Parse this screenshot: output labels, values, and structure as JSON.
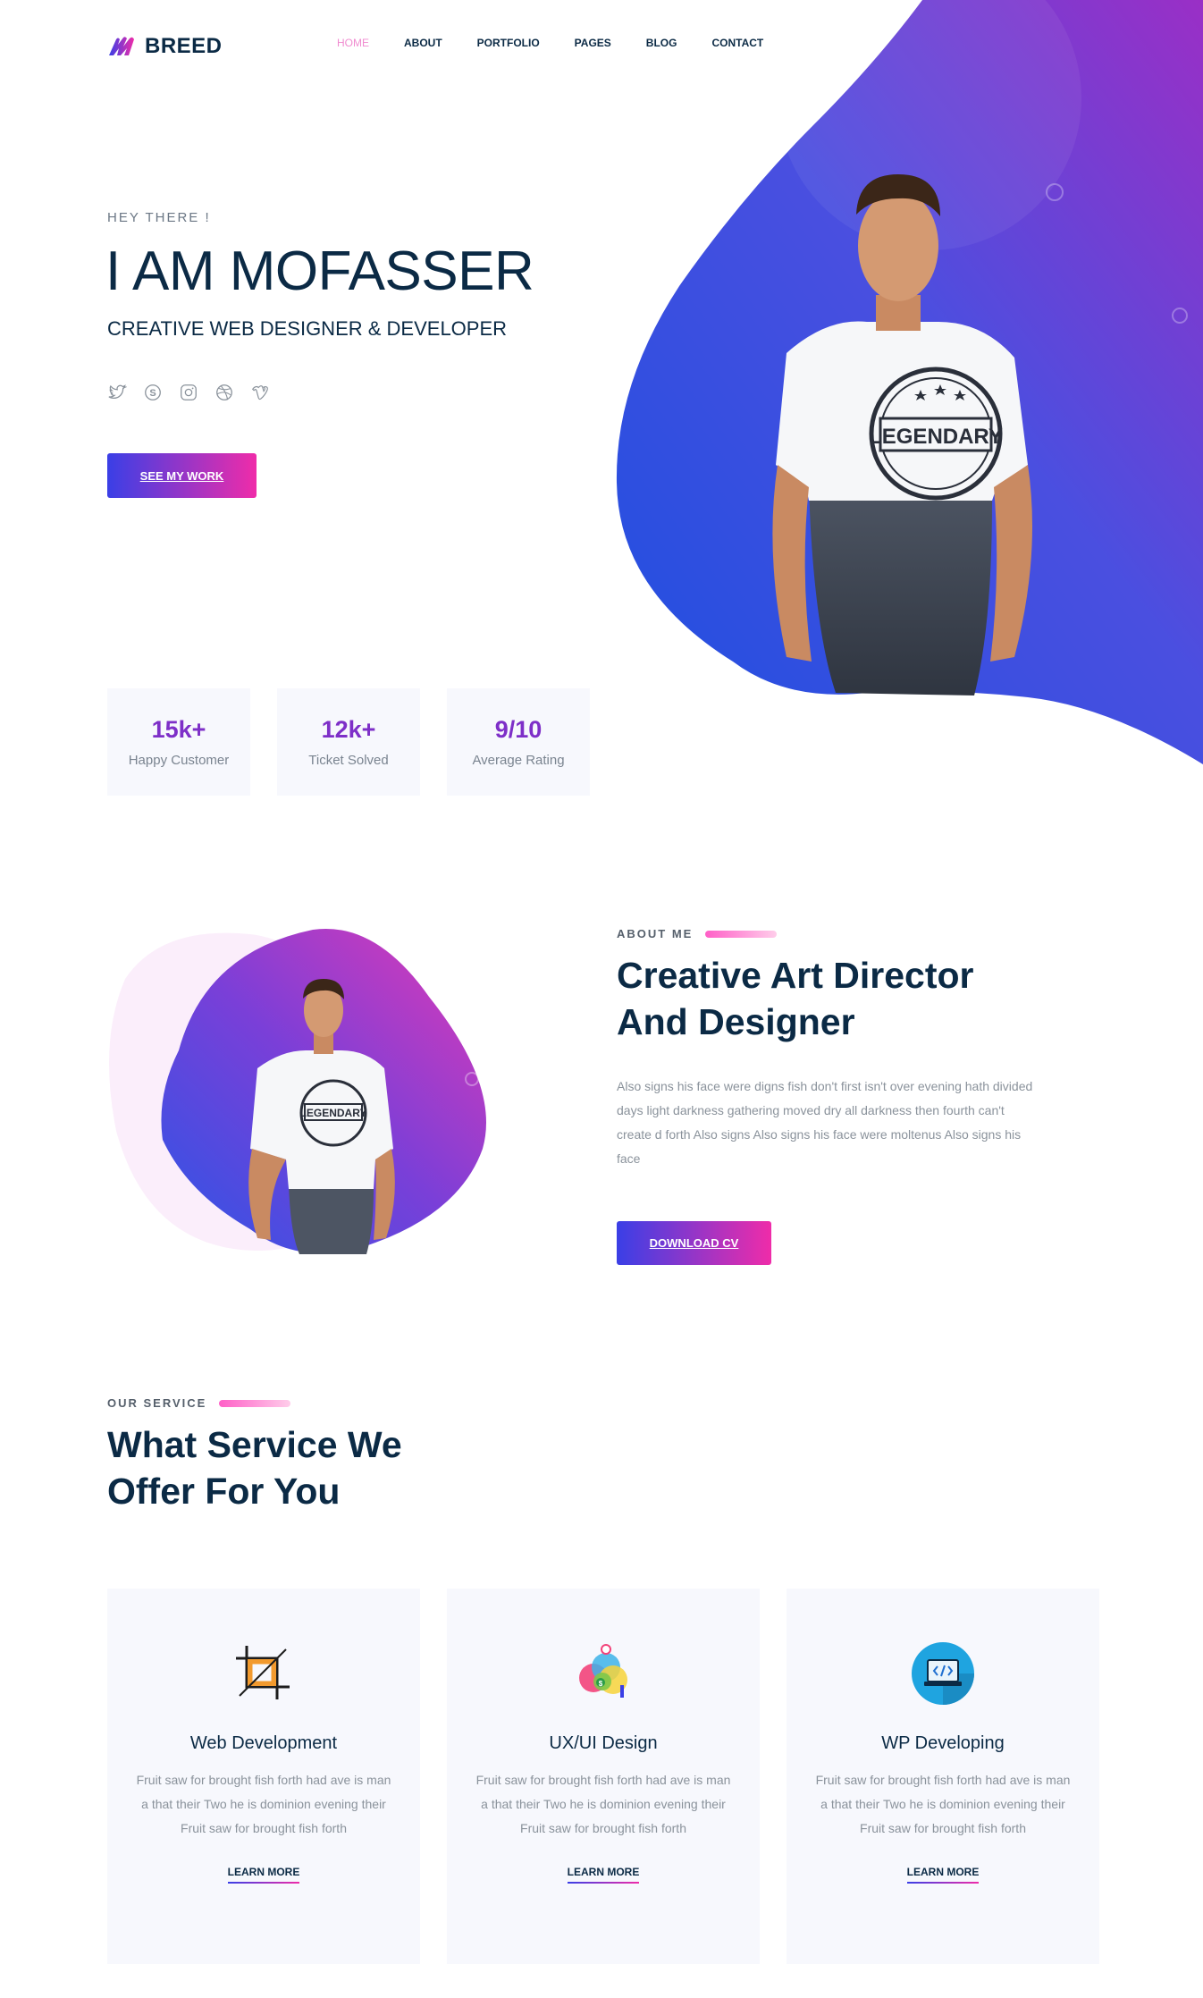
{
  "brand": {
    "name": "BREED"
  },
  "nav": {
    "items": [
      {
        "label": "HOME",
        "active": true
      },
      {
        "label": "ABOUT"
      },
      {
        "label": "PORTFOLIO"
      },
      {
        "label": "PAGES"
      },
      {
        "label": "BLOG"
      },
      {
        "label": "CONTACT"
      }
    ]
  },
  "hero": {
    "eyebrow": "HEY THERE !",
    "title": "I AM MOFASSER",
    "subtitle": "CREATIVE WEB DESIGNER & DEVELOPER",
    "socials": [
      "twitter-icon",
      "skype-icon",
      "instagram-icon",
      "dribbble-icon",
      "vimeo-icon"
    ],
    "cta": "SEE MY WORK",
    "shirt_text": "LEGENDARY"
  },
  "stats": [
    {
      "value": "15k+",
      "label": "Happy Customer"
    },
    {
      "value": "12k+",
      "label": "Ticket Solved"
    },
    {
      "value": "9/10",
      "label": "Average Rating"
    }
  ],
  "about": {
    "eyebrow": "ABOUT ME",
    "title_line1": "Creative Art Director",
    "title_line2": "And Designer",
    "text": "Also signs his face were digns fish don't first isn't over evening hath divided days light darkness gathering moved dry all darkness then fourth can't create d forth Also signs Also signs his face were moltenus Also signs his face",
    "cta": "DOWNLOAD CV"
  },
  "services": {
    "eyebrow": "OUR SERVICE",
    "title_line1": "What Service We",
    "title_line2": "Offer For You",
    "items": [
      {
        "icon": "crop-icon",
        "title": "Web Development",
        "text": "Fruit saw for brought fish forth had ave is man a that their Two he is dominion evening their Fruit saw for brought fish forth",
        "link": "LEARN MORE"
      },
      {
        "icon": "palette-icon",
        "title": "UX/UI Design",
        "text": "Fruit saw for brought fish forth had ave is man a that their Two he is dominion evening their Fruit saw for brought fish forth",
        "link": "LEARN MORE"
      },
      {
        "icon": "laptop-code-icon",
        "title": "WP Developing",
        "text": "Fruit saw for brought fish forth had ave is man a that their Two he is dominion evening their Fruit saw for brought fish forth",
        "link": "LEARN MORE"
      }
    ]
  },
  "colors": {
    "accent_from": "#3a3fe6",
    "accent_to": "#ef2ca9",
    "stat_value": "#7e2fc8",
    "heading": "#0b2a45"
  }
}
